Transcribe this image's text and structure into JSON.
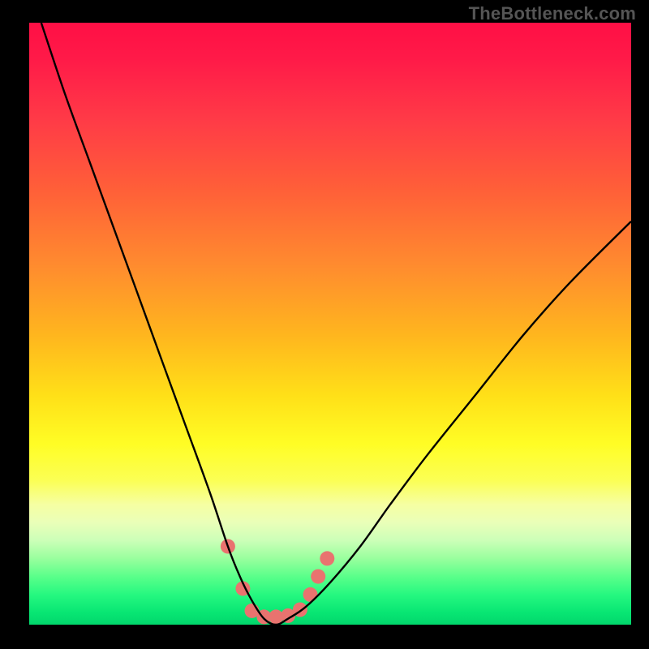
{
  "watermark": "TheBottleneck.com",
  "chart_data": {
    "type": "line",
    "title": "",
    "xlabel": "",
    "ylabel": "",
    "xlim": [
      0,
      100
    ],
    "ylim": [
      0,
      100
    ],
    "series": [
      {
        "name": "bottleneck-curve",
        "x": [
          2,
          6,
          10,
          14,
          18,
          22,
          26,
          30,
          33,
          35,
          37,
          39,
          41,
          43,
          46,
          50,
          55,
          60,
          66,
          74,
          82,
          90,
          100
        ],
        "values": [
          100,
          88,
          77,
          66,
          55,
          44,
          33,
          22,
          13,
          8,
          4,
          1,
          0,
          1,
          3,
          7,
          13,
          20,
          28,
          38,
          48,
          57,
          67
        ]
      }
    ],
    "markers": {
      "name": "highlight-dots",
      "points": [
        {
          "x": 33.0,
          "y": 13.0
        },
        {
          "x": 35.5,
          "y": 6.0
        },
        {
          "x": 37.0,
          "y": 2.3
        },
        {
          "x": 39.0,
          "y": 1.3
        },
        {
          "x": 41.0,
          "y": 1.3
        },
        {
          "x": 43.0,
          "y": 1.5
        },
        {
          "x": 45.0,
          "y": 2.5
        },
        {
          "x": 46.7,
          "y": 5.0
        },
        {
          "x": 48.0,
          "y": 8.0
        },
        {
          "x": 49.5,
          "y": 11.0
        }
      ],
      "radius_px": 9,
      "color": "#e9736f"
    },
    "curve_color": "#000000"
  }
}
